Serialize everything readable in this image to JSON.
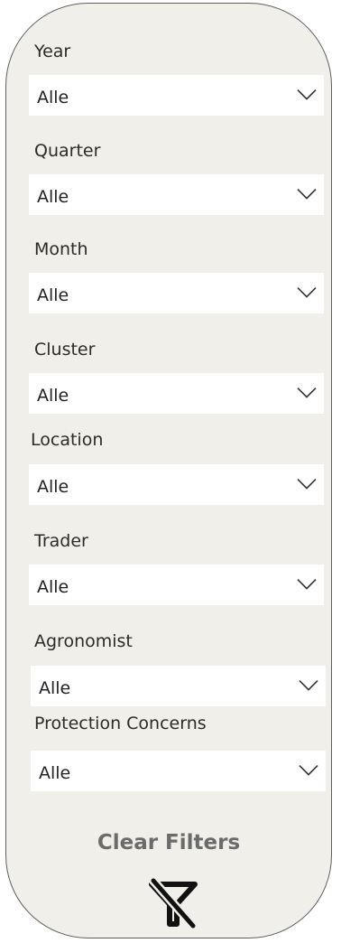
{
  "filters": [
    {
      "label": "Year",
      "value": "Alle"
    },
    {
      "label": "Quarter",
      "value": "Alle"
    },
    {
      "label": "Month",
      "value": "Alle"
    },
    {
      "label": "Cluster",
      "value": "Alle"
    },
    {
      "label": "Location",
      "value": "Alle"
    },
    {
      "label": "Trader",
      "value": "Alle"
    },
    {
      "label": "Agronomist",
      "value": "Alle"
    },
    {
      "label": "Protection Concerns",
      "value": "Alle"
    }
  ],
  "clear_filters": {
    "label": "Clear Filters",
    "icon": "filter-clear-icon"
  },
  "colors": {
    "panel_background": "#f0efea",
    "panel_border": "#5e5e5e",
    "dropdown_background": "#ffffff",
    "clear_label": "#6b6b6b"
  }
}
